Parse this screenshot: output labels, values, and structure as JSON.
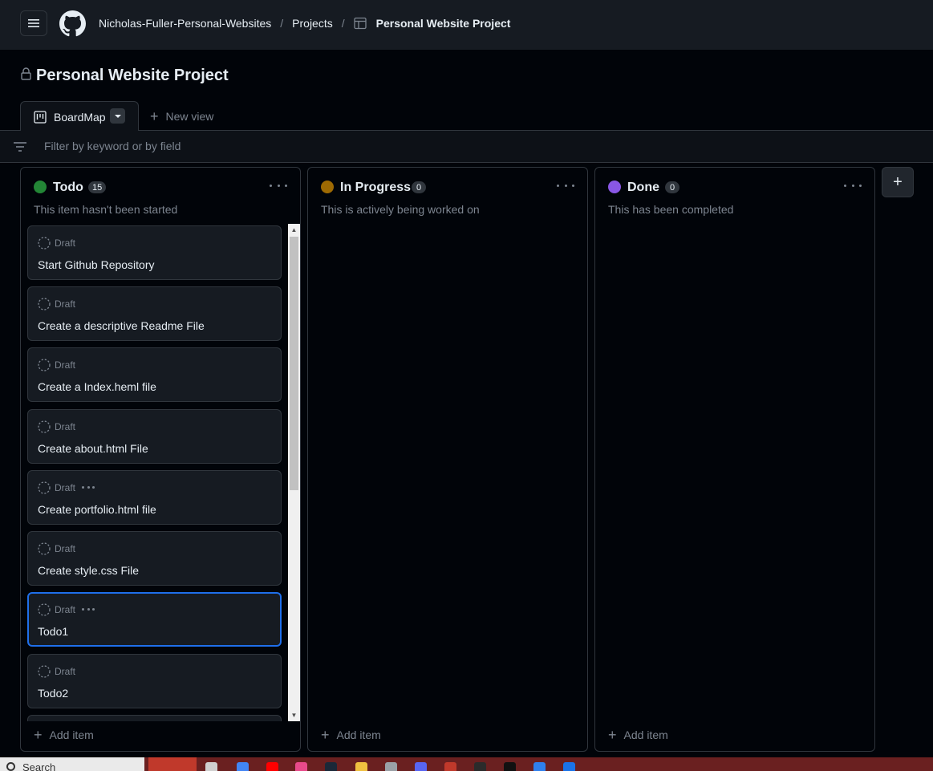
{
  "header": {
    "org": "Nicholas-Fuller-Personal-Websites",
    "sep1": "/",
    "projects": "Projects",
    "sep2": "/",
    "project": "Personal Website Project"
  },
  "title": "Personal Website Project",
  "tabs": {
    "board": "BoardMap",
    "new_view": "New view"
  },
  "filter": {
    "placeholder": "Filter by keyword or by field"
  },
  "columns": [
    {
      "name": "Todo",
      "count": "15",
      "color": "#238636",
      "description": "This item hasn't been started",
      "add_label": "Add item",
      "cards": [
        {
          "status": "Draft",
          "title": "Start Github Repository"
        },
        {
          "status": "Draft",
          "title": "Create a descriptive Readme File"
        },
        {
          "status": "Draft",
          "title": "Create a Index.heml file"
        },
        {
          "status": "Draft",
          "title": "Create about.html File"
        },
        {
          "status": "Draft",
          "title": "Create portfolio.html file"
        },
        {
          "status": "Draft",
          "title": "Create style.css File"
        },
        {
          "status": "Draft",
          "title": "Todo1"
        },
        {
          "status": "Draft",
          "title": "Todo2"
        }
      ]
    },
    {
      "name": "In Progress",
      "count": "0",
      "color": "#9e6a03",
      "description": "This is actively being worked on",
      "add_label": "Add item",
      "cards": []
    },
    {
      "name": "Done",
      "count": "0",
      "color": "#8957e5",
      "description": "This has been completed",
      "add_label": "Add item",
      "cards": []
    }
  ],
  "taskbar": {
    "search": "Search"
  }
}
